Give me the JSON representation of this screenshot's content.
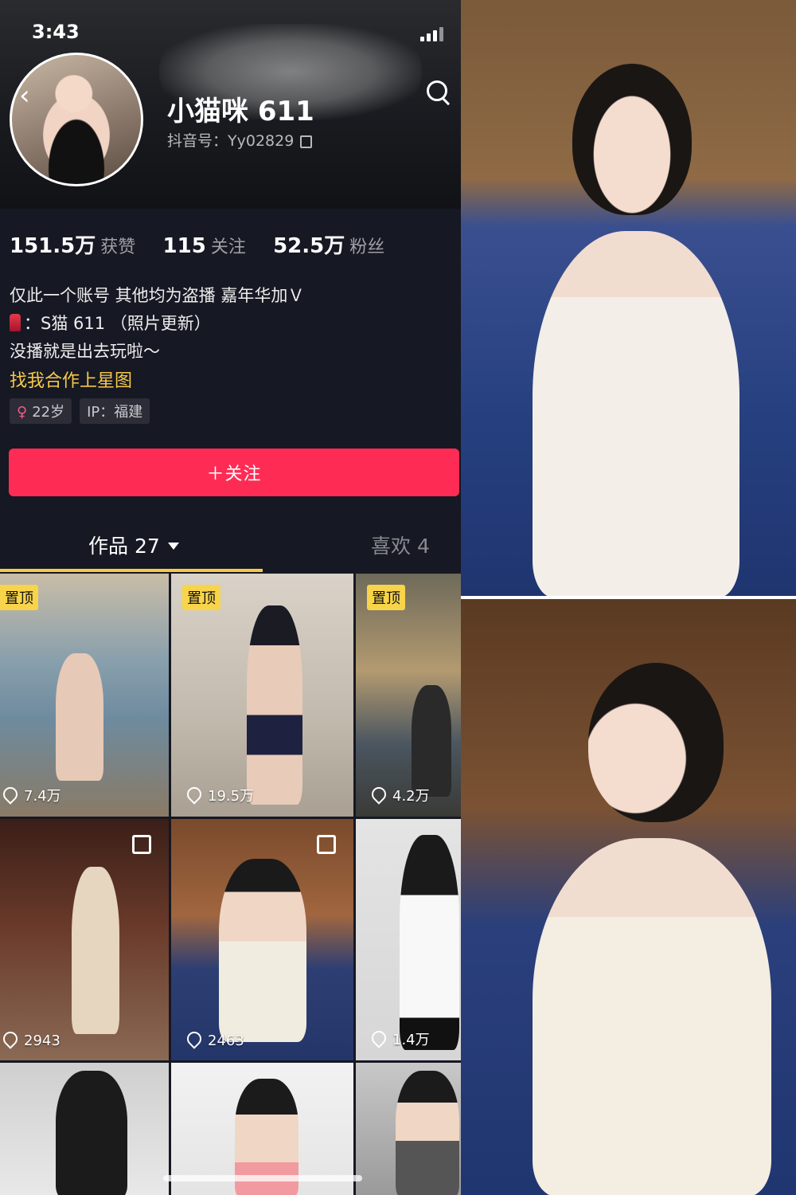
{
  "status": {
    "time": "3:43"
  },
  "profile": {
    "username": "小猫咪 611",
    "douyin_id": "抖音号：Yy02829",
    "stats": [
      {
        "value": "151.5万",
        "label": "获赞"
      },
      {
        "value": "115",
        "label": "关注"
      },
      {
        "value": "52.5万",
        "label": "粉丝"
      }
    ],
    "bio": [
      "仅此一个账号 其他均为盗播 嘉年华加Ｖ",
      "：S猫 611 （照片更新）",
      "没播就是出去玩啦～"
    ],
    "business_link": "找我合作上星图",
    "tags": {
      "age": "22岁",
      "ip": "IP：福建"
    },
    "follow_label": "＋关注"
  },
  "tabs": {
    "works": "作品 27",
    "likes": "喜欢 4"
  },
  "grid": {
    "pin_label": "置顶",
    "items": [
      {
        "likes": "7.4万",
        "pinned": true,
        "multi": false
      },
      {
        "likes": "19.5万",
        "pinned": true,
        "multi": false
      },
      {
        "likes": "4.2万",
        "pinned": true,
        "multi": false
      },
      {
        "likes": "2943",
        "pinned": false,
        "multi": true
      },
      {
        "likes": "2463",
        "pinned": false,
        "multi": true
      },
      {
        "likes": "1.4万",
        "pinned": false,
        "multi": false
      },
      {
        "likes": "",
        "pinned": false,
        "multi": false
      },
      {
        "likes": "",
        "pinned": false,
        "multi": false
      },
      {
        "likes": "",
        "pinned": false,
        "multi": false
      }
    ]
  },
  "colors": {
    "accent": "#fe2c55",
    "link": "#f7c94a",
    "background": "#161823"
  }
}
